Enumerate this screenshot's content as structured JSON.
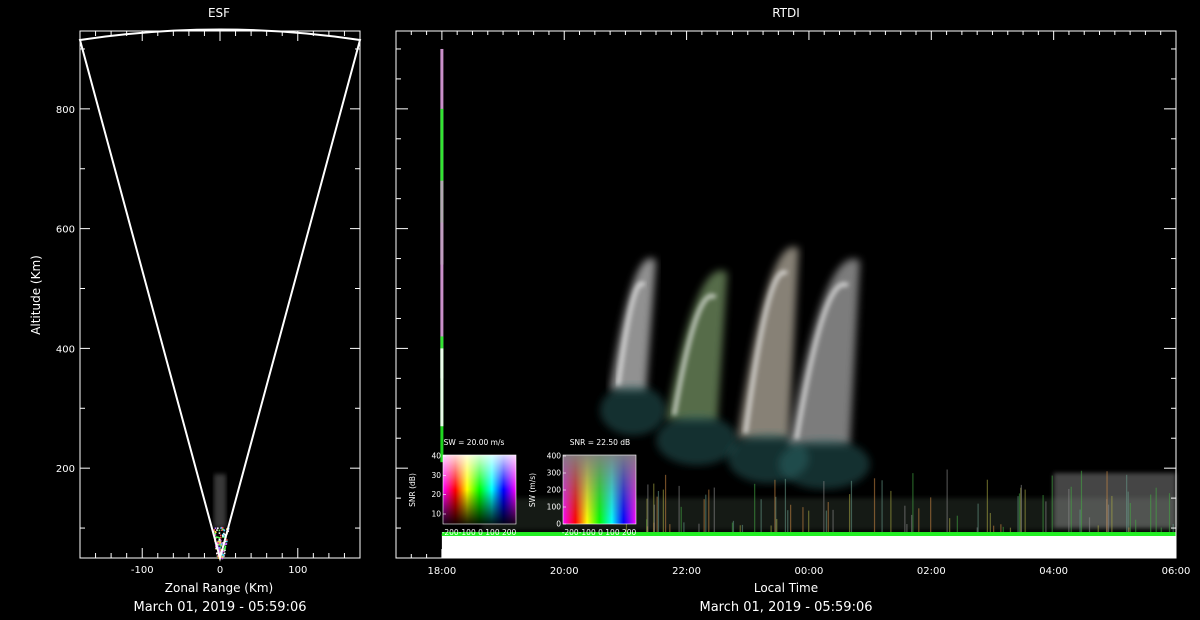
{
  "colors": {
    "background": "#000000",
    "frame": "#ffffff"
  },
  "chart_data": [
    {
      "type": "scatter",
      "panel": "esf",
      "title": "ESF",
      "xlabel": "Zonal Range (Km)",
      "ylabel": "Altitude (Km)",
      "date_label": "March 01, 2019 - 05:59:06",
      "xlim": [
        -180,
        180
      ],
      "ylim": [
        50,
        930
      ],
      "x_ticks": [
        -100,
        0,
        100
      ],
      "y_ticks": [
        200,
        400,
        600,
        800
      ],
      "fan_edges": [
        [
          -180,
          915
        ],
        [
          0,
          50
        ],
        [
          180,
          915
        ]
      ],
      "echo_region": {
        "x": [
          -20,
          20
        ],
        "y": [
          50,
          190
        ]
      }
    },
    {
      "type": "heatmap",
      "panel": "rtdi",
      "title": "RTDI",
      "xlabel": "Local Time",
      "date_label": "March 01, 2019 - 05:59:06",
      "x_ticks": [
        "18:00",
        "20:00",
        "22:00",
        "00:00",
        "02:00",
        "04:00",
        "06:00"
      ],
      "x_range_hours": [
        17.25,
        30
      ],
      "ylim": [
        50,
        930
      ],
      "plumes": [
        {
          "t_start": "20:45",
          "t_end": "21:30",
          "alt_low": 330,
          "alt_high": 580,
          "color": "#cfcfcf"
        },
        {
          "t_start": "21:40",
          "t_end": "22:40",
          "alt_low": 280,
          "alt_high": 560,
          "color": "#7a9a6a"
        },
        {
          "t_start": "22:50",
          "t_end": "23:50",
          "alt_low": 250,
          "alt_high": 600,
          "color": "#c0b8a8"
        },
        {
          "t_start": "23:40",
          "t_end": "00:50",
          "alt_low": 240,
          "alt_high": 580,
          "color": "#b0b0b0"
        }
      ],
      "insets": [
        {
          "title": "SW = 20.00 m/s",
          "ylabel": "SNR (dB)",
          "y_ticks": [
            10,
            20,
            30,
            40
          ],
          "x_ticks_text": "-200-100  0  100 200"
        },
        {
          "title": "SNR = 22.50 dB",
          "ylabel": "SW (m/s)",
          "y_ticks": [
            0,
            100,
            200,
            300,
            400
          ],
          "x_ticks_text": "-200-100  0  100 200"
        }
      ]
    }
  ]
}
